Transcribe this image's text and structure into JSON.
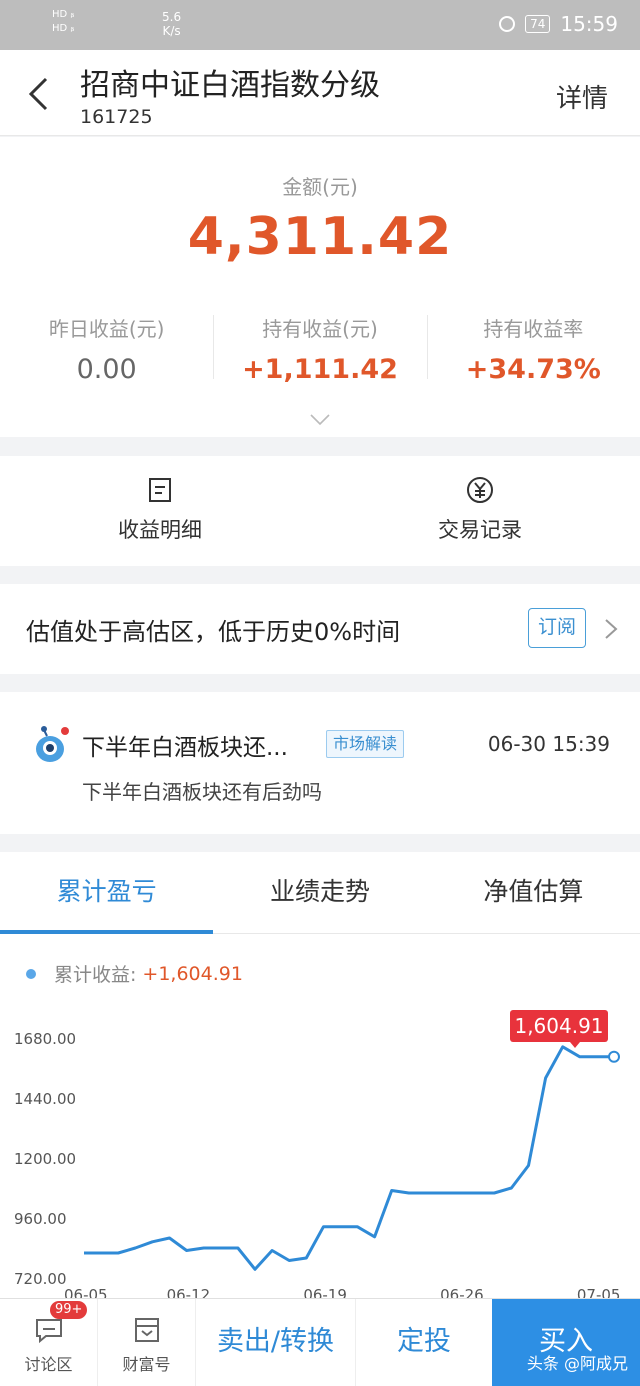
{
  "status_bar": {
    "sim1": "HD ᵦ",
    "sim2": "HD ᵦ",
    "net_speed_value": "5.6",
    "net_speed_unit": "K/s",
    "battery": "74",
    "time": "15:59"
  },
  "header": {
    "title": "招商中证白酒指数分级",
    "code": "161725",
    "detail_label": "详情"
  },
  "summary": {
    "amount_label": "金额(元)",
    "amount_value": "4,311.42",
    "stats": [
      {
        "label": "昨日收益(元)",
        "value": "0.00"
      },
      {
        "label": "持有收益(元)",
        "value": "+1,111.42"
      },
      {
        "label": "持有收益率",
        "value": "+34.73%"
      }
    ]
  },
  "shortcuts": [
    {
      "label": "收益明细",
      "icon": "document-icon"
    },
    {
      "label": "交易记录",
      "icon": "yen-circle-icon"
    }
  ],
  "valuation": {
    "text": "估值处于高估区，低于历史0%时间",
    "subscribe_label": "订阅"
  },
  "news": {
    "title": "下半年白酒板块还...",
    "tag": "市场解读",
    "time": "06-30 15:39",
    "subtitle": "下半年白酒板块还有后劲吗"
  },
  "tabs": [
    {
      "label": "累计盈亏",
      "active": true
    },
    {
      "label": "业绩走势",
      "active": false
    },
    {
      "label": "净值估算",
      "active": false
    }
  ],
  "legend": {
    "label": "累计收益:",
    "value": "+1,604.91"
  },
  "chart_data": {
    "type": "line",
    "y_ticks": [
      "1680.00",
      "1440.00",
      "1200.00",
      "960.00",
      "720.00"
    ],
    "y_tick_values": [
      1680,
      1440,
      1200,
      960,
      720
    ],
    "x_ticks": [
      "06-05",
      "06-12",
      "06-19",
      "06-26",
      "07-05"
    ],
    "x_tick_indices": [
      0,
      5,
      11,
      17,
      23
    ],
    "ylim": [
      720,
      1680
    ],
    "series": [
      {
        "values": [
          820,
          820,
          820,
          840,
          865,
          880,
          830,
          840,
          840,
          840,
          755,
          830,
          790,
          800,
          925,
          925,
          925,
          885,
          1070,
          1060,
          1060,
          1060,
          1060,
          1060,
          1060,
          1080,
          1170,
          1520,
          1645,
          1605,
          1605,
          1605
        ]
      }
    ],
    "callout": "1,604.91",
    "line_color": "#2f8ad6",
    "callout_color": "#e8333c"
  },
  "bottom_bar": {
    "discuss_label": "讨论区",
    "discuss_badge": "99+",
    "wealth_label": "财富号",
    "sell_label": "卖出/转换",
    "plan_label": "定投",
    "buy_label": "买入"
  },
  "watermark": "头条 @阿成兄"
}
